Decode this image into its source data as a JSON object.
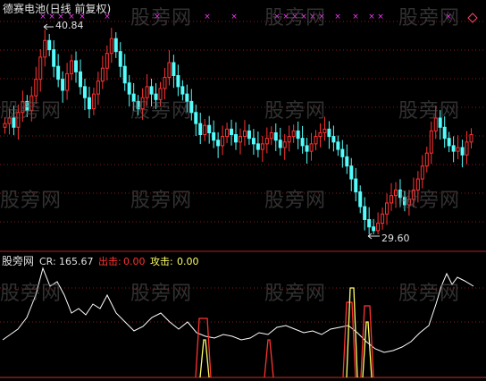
{
  "main_panel": {
    "title": "德赛电池(日线 前复权)",
    "high_marker": "40.84",
    "low_marker": "29.60",
    "corner_icon": "diamond-icon"
  },
  "indicator_panel": {
    "name": "股旁网",
    "cr_label": "CR:",
    "cr_value": "165.67",
    "out_label": "出击:",
    "out_value": "0.00",
    "attack_label": "攻击:",
    "attack_value": "0.00"
  },
  "watermark": "股旁网",
  "colors": {
    "up": "#ff3333",
    "down": "#54fcfc",
    "cr_line": "#ffffff",
    "out_line": "#ff3333",
    "attack_line": "#ffff66",
    "marker": "#ff33ff",
    "grid": "#8a1a1a"
  },
  "chart_data": {
    "type": "candlestick",
    "price_high": 40.84,
    "price_low": 29.6,
    "cr_current": 165.67,
    "out_current": 0.0,
    "attack_current": 0.0
  }
}
